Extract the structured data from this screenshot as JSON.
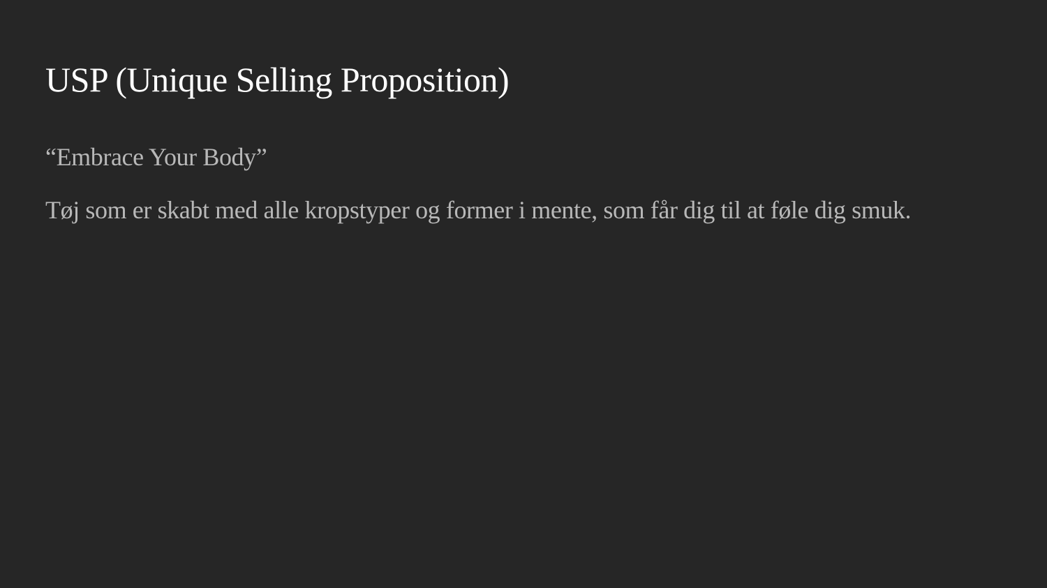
{
  "slide": {
    "title": "USP (Unique Selling Proposition)",
    "tagline": "“Embrace Your Body”",
    "description": "Tøj som er skabt med alle kropstyper og former i mente, som får dig til at føle dig smuk."
  },
  "colors": {
    "background": "#262626",
    "title": "#ffffff",
    "body_text": "#b8b8b8"
  }
}
